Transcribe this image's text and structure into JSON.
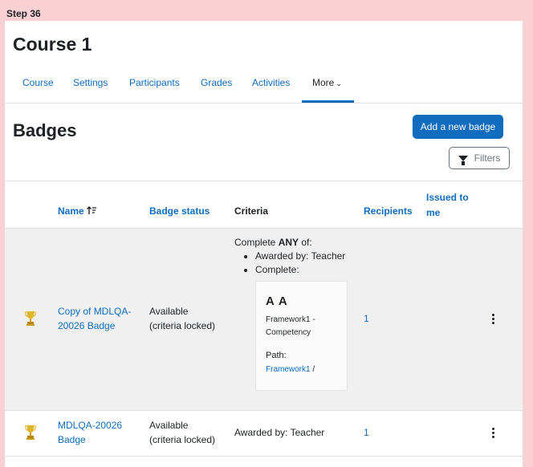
{
  "step_label": "Step 36",
  "course": {
    "title": "Course 1"
  },
  "nav": {
    "items": [
      "Course",
      "Settings",
      "Participants",
      "Grades",
      "Activities"
    ],
    "more": "More"
  },
  "page": {
    "title": "Badges",
    "add_button": "Add a new badge",
    "filters_button": "Filters"
  },
  "table": {
    "headers": {
      "name": "Name",
      "badge_status": "Badge status",
      "criteria": "Criteria",
      "recipients": "Recipients",
      "issued_line1": "Issued to",
      "issued_line2": "me"
    },
    "rows": [
      {
        "name_line1": "Copy of MDLQA-",
        "name_line2": "20026 Badge",
        "status_line1": "Available",
        "status_line2": "(criteria locked)",
        "criteria": {
          "intro_prefix": "Complete ",
          "intro_strong": "ANY",
          "intro_suffix": " of:",
          "item1": "Awarded by: Teacher",
          "item2": "Complete:",
          "competency": {
            "abbr": "A A",
            "name": "Framework1 - Competency",
            "path_label": "Path:",
            "path_link": "Framework1",
            "path_sep": " /"
          }
        },
        "recipients": "1"
      },
      {
        "name_line1": "MDLQA-20026",
        "name_line2": "Badge",
        "status_line1": "Available",
        "status_line2": "(criteria locked)",
        "criteria_text": "Awarded by: Teacher",
        "recipients": "1"
      }
    ]
  },
  "colors": {
    "accent": "#0f6cbf",
    "page_bg": "#f9d0d4",
    "row_highlight": "#f0f0f0",
    "trophy": "#e1b52b"
  },
  "icons": [
    "sort-ascending-icon",
    "chevron-down-icon",
    "filter-icon",
    "trophy-icon",
    "kebab-menu-icon"
  ]
}
